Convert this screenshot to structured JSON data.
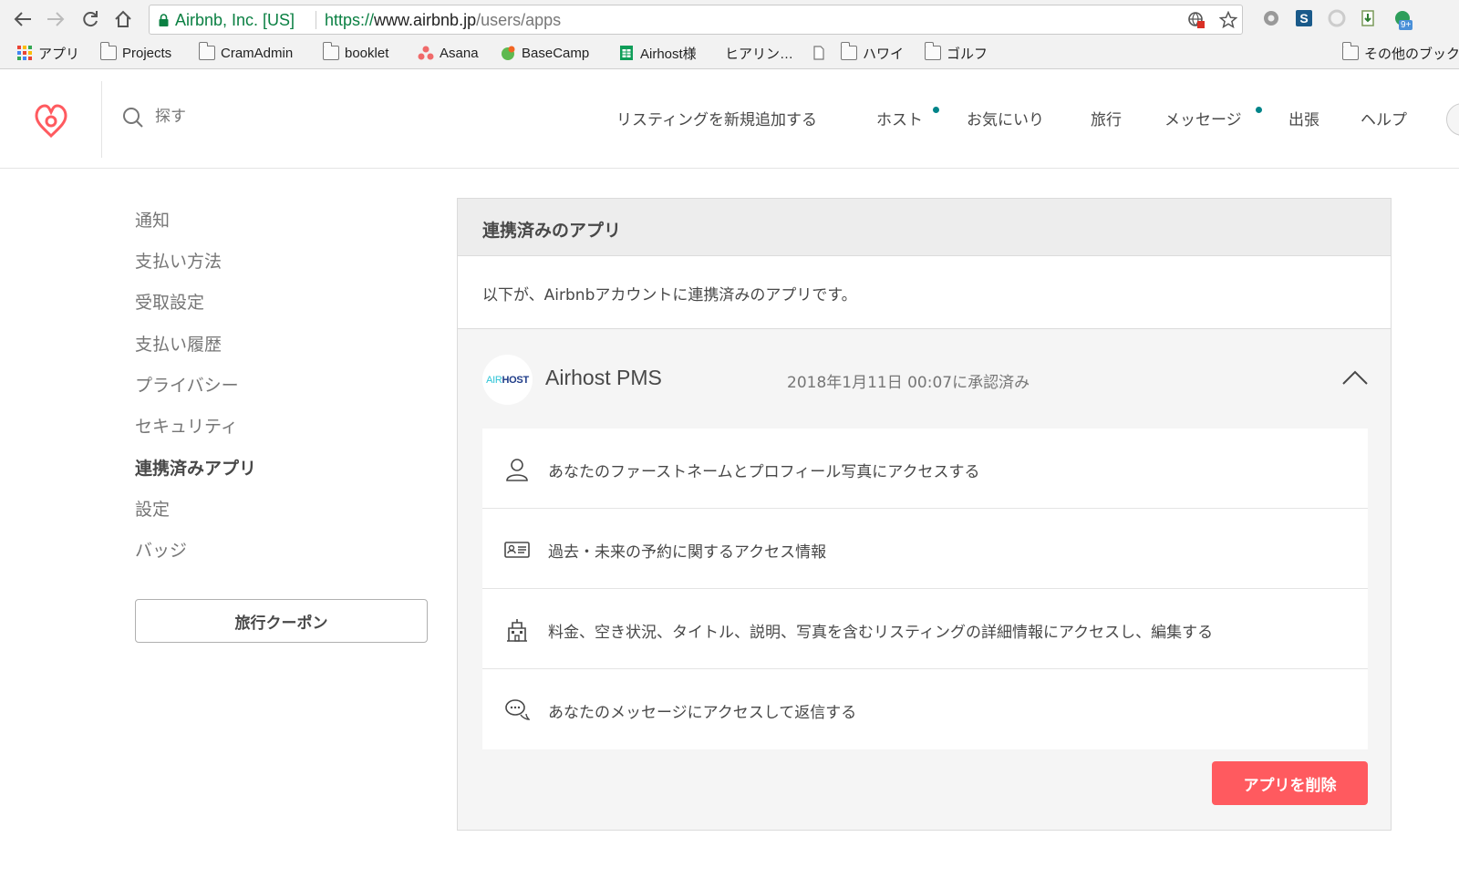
{
  "browser": {
    "site_identity": "Airbnb, Inc. [US]",
    "url_scheme": "https://",
    "url_host": "www.airbnb.jp",
    "url_path": "/users/apps",
    "bookmarks": [
      "アプリ",
      "Projects",
      "CramAdmin",
      "booklet",
      "Asana",
      "BaseCamp",
      "Airhost様",
      "ヒアリン…",
      "ハワイ",
      "ゴルフ",
      "その他のブック"
    ],
    "extension_badge": "9+"
  },
  "header": {
    "search_placeholder": "探す",
    "nav": [
      "リスティングを新規追加する",
      "ホスト",
      "お気にいり",
      "旅行",
      "メッセージ",
      "出張",
      "ヘルプ"
    ]
  },
  "sidebar": {
    "items": [
      "通知",
      "支払い方法",
      "受取設定",
      "支払い履歴",
      "プライバシー",
      "セキュリティ",
      "連携済みアプリ",
      "設定",
      "バッジ"
    ],
    "active_item": "連携済みアプリ",
    "coupon_button": "旅行クーポン"
  },
  "panel": {
    "title": "連携済みのアプリ",
    "description": "以下が、Airbnbアカウントに連携済みのアプリです。",
    "app": {
      "logo_text_1": "AIR",
      "logo_text_2": "HOST",
      "name": "Airhost PMS",
      "approved": "2018年1月11日 00:07に承認済み",
      "permissions": [
        {
          "icon": "user-icon",
          "text": "あなたのファーストネームとプロフィール写真にアクセスする"
        },
        {
          "icon": "id-card-icon",
          "text": "過去・未来の予約に関するアクセス情報"
        },
        {
          "icon": "building-icon",
          "text": "料金、空き状況、タイトル、説明、写真を含むリスティングの詳細情報にアクセスし、編集する"
        },
        {
          "icon": "chat-bubble-icon",
          "text": "あなたのメッセージにアクセスして返信する"
        }
      ]
    },
    "delete_button": "アプリを削除"
  },
  "colors": {
    "brand": "#ff5a5f",
    "teal_dot": "#008489",
    "secure_green": "#0b8043"
  }
}
